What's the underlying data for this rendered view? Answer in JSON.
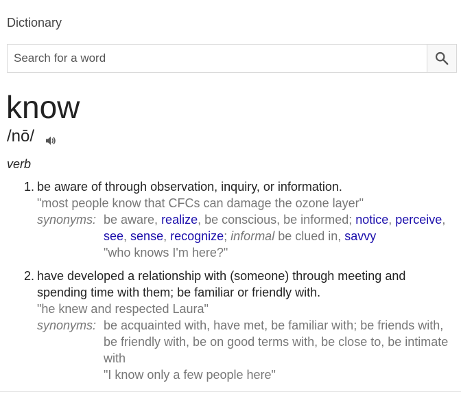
{
  "header": {
    "title": "Dictionary"
  },
  "search": {
    "placeholder": "Search for a word"
  },
  "entry": {
    "word": "know",
    "pronunciation": "/nō/",
    "part_of_speech": "verb",
    "definitions": [
      {
        "number": "1.",
        "text": "be aware of through observation, inquiry, or information.",
        "example": "\"most people know that CFCs can damage the ozone layer\"",
        "synonyms_label": "synonyms:",
        "syn_plain_1": "be aware, ",
        "syn_link_1": "realize",
        "syn_plain_2": ", be conscious, be informed; ",
        "syn_link_2": "notice",
        "syn_plain_3": ", ",
        "syn_link_3": "perceive",
        "syn_plain_4": ", ",
        "syn_link_4": "see",
        "syn_plain_5": ", ",
        "syn_link_5": "sense",
        "syn_plain_6": ", ",
        "syn_link_6": "recognize",
        "syn_plain_7": "; ",
        "syn_qualifier": "informal",
        "syn_plain_8": " be clued in, ",
        "syn_link_7": "savvy",
        "synonym_example": "\"who knows I'm here?\""
      },
      {
        "number": "2.",
        "text": "have developed a relationship with (someone) through meeting and spending time with them; be familiar or friendly with.",
        "example": "\"he knew and respected Laura\"",
        "synonyms_label": "synonyms:",
        "synonyms_text": "be acquainted with, have met, be familiar with; be friends with, be friendly with, be on good terms with, be close to, be intimate with",
        "synonym_example": "\"I know only a few people here\""
      }
    ]
  }
}
